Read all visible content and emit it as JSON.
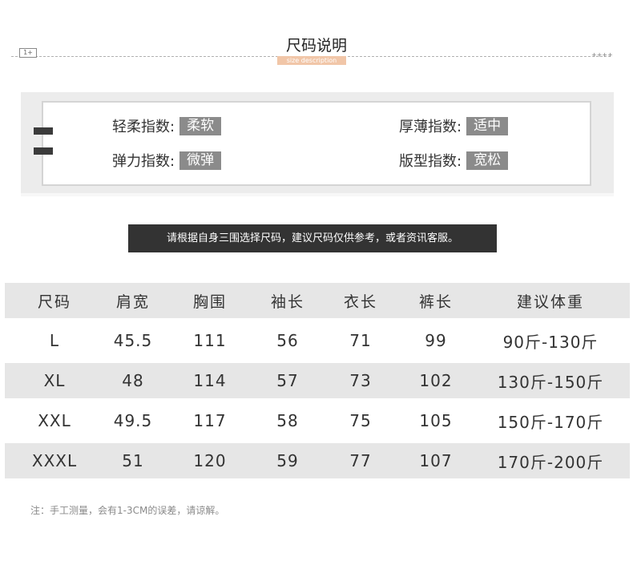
{
  "header": {
    "title": "尺码说明",
    "subtitle": "size description",
    "box_label": "1+",
    "plus_marks": "++++"
  },
  "indices": [
    {
      "label": "轻柔指数:",
      "value": "柔软"
    },
    {
      "label": "厚薄指数:",
      "value": "适中"
    },
    {
      "label": "弹力指数:",
      "value": "微弹"
    },
    {
      "label": "版型指数:",
      "value": "宽松"
    }
  ],
  "notice": "请根据自身三围选择尺码，建议尺码仅供参考，或者资讯客服。",
  "table": {
    "headers": [
      "尺码",
      "肩宽",
      "胸围",
      "袖长",
      "衣长",
      "裤长",
      "建议体重"
    ],
    "rows": [
      [
        "L",
        "45.5",
        "111",
        "56",
        "71",
        "99",
        "90斤-130斤"
      ],
      [
        "XL",
        "48",
        "114",
        "57",
        "73",
        "102",
        "130斤-150斤"
      ],
      [
        "XXL",
        "49.5",
        "117",
        "58",
        "75",
        "105",
        "150斤-170斤"
      ],
      [
        "XXXL",
        "51",
        "120",
        "59",
        "77",
        "107",
        "170斤-200斤"
      ]
    ]
  },
  "footnote": "注：手工测量，会有1-3CM的误差，请谅解。",
  "colors": {
    "panel_background": "#ececec",
    "tag_background": "#8b8b8b",
    "notice_background": "#333333",
    "row_shade": "#e6e6e6",
    "subtitle_background": "#f1c6a8"
  }
}
